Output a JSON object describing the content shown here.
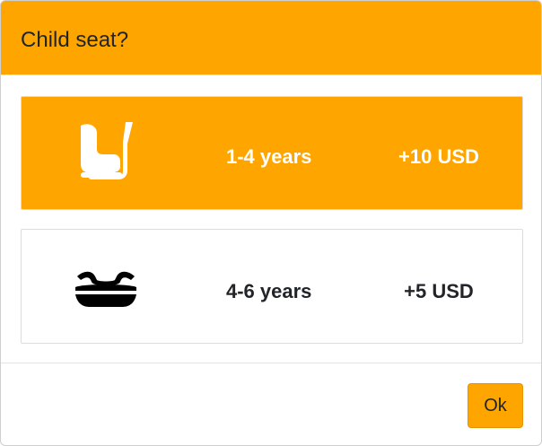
{
  "dialog": {
    "title": "Child seat?"
  },
  "options": [
    {
      "label": "1-4 years",
      "price": "+10 USD",
      "icon": "child-car-seat-icon",
      "selected": true
    },
    {
      "label": "4-6 years",
      "price": "+5 USD",
      "icon": "booster-seat-icon",
      "selected": false
    }
  ],
  "footer": {
    "ok_label": "Ok"
  },
  "colors": {
    "accent": "#FFA500",
    "text": "#212529",
    "selected_text": "#FFFFFF"
  }
}
